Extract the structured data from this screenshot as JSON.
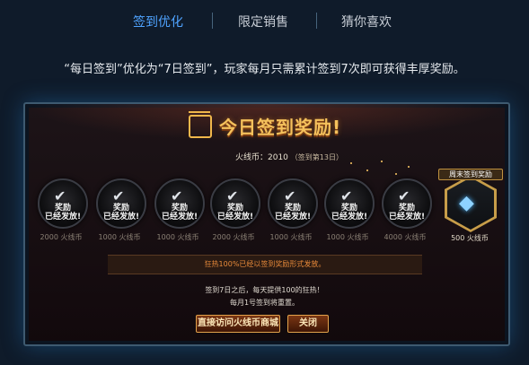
{
  "tabs": [
    {
      "label": "签到优化",
      "active": true
    },
    {
      "label": "限定销售",
      "active": false
    },
    {
      "label": "猜你喜欢",
      "active": false
    }
  ],
  "description": "“每日签到”优化为“7日签到”，玩家每月只需累计签到7次即可获得丰厚奖励。",
  "panel": {
    "title": "今日签到奖励!",
    "balance_label": "火线币：2010",
    "balance_note": "（签到第13日）",
    "rewards": [
      {
        "stamp": "奖励\n已经发放!",
        "label": "2000 火线币"
      },
      {
        "stamp": "奖励\n已经发放!",
        "label": "1000 火线币"
      },
      {
        "stamp": "奖励\n已经发放!",
        "label": "1000 火线币"
      },
      {
        "stamp": "奖励\n已经发放!",
        "label": "2000 火线币"
      },
      {
        "stamp": "奖励\n已经发放!",
        "label": "1000 火线币"
      },
      {
        "stamp": "奖励\n已经发放!",
        "label": "1000 火线币"
      },
      {
        "stamp": "奖励\n已经发放!",
        "label": "4000 火线币"
      }
    ],
    "final_reward": {
      "tag": "周末签到奖励",
      "label": "500 火线币"
    },
    "notice": "狂热100%已经以签到奖励形式发放。",
    "info_line1": "签到7日之后，每天提供100的狂热！",
    "info_line2": "每月1号签到将重置。",
    "buttons": {
      "shop": "直接访问火线币商城",
      "close": "关闭"
    }
  },
  "colors": {
    "accent": "#4fa3ff",
    "gold": "#f5c15c",
    "notice": "#e88a3a"
  }
}
